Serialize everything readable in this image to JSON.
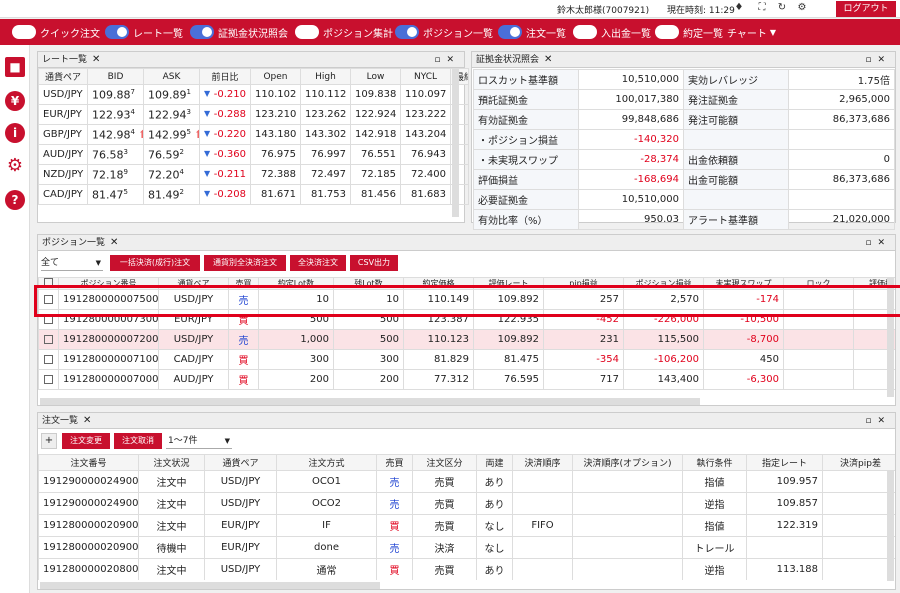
{
  "topbar": {
    "user": "鈴木太郎様(7007921)",
    "time": "現在時刻: 11:29",
    "logout": "ログアウト"
  },
  "toolbar": {
    "items": [
      {
        "label": "クイック注文",
        "on": false
      },
      {
        "label": "レート一覧",
        "on": true
      },
      {
        "label": "証拠金状況照会",
        "on": true
      },
      {
        "label": "ポジション集計",
        "on": false
      },
      {
        "label": "ポジション一覧",
        "on": true
      },
      {
        "label": "注文一覧",
        "on": true
      },
      {
        "label": "入出金一覧",
        "on": false
      },
      {
        "label": "約定一覧",
        "on": false
      }
    ],
    "chart": "チャート"
  },
  "rate_panel": {
    "title": "レート一覧",
    "headers": [
      "通貨ペア",
      "BID",
      "ASK",
      "前日比",
      "Open",
      "High",
      "Low",
      "NYCL",
      "最終"
    ],
    "rows": [
      {
        "pair": "USD/JPY",
        "bid": "109.88",
        "bid_sup": "7",
        "ask": "109.89",
        "ask_sup": "1",
        "change": "-0.210",
        "open": "110.102",
        "high": "110.112",
        "low": "109.838",
        "nycl": "110.097",
        "arrow": ""
      },
      {
        "pair": "EUR/JPY",
        "bid": "122.93",
        "bid_sup": "4",
        "ask": "122.94",
        "ask_sup": "3",
        "change": "-0.288",
        "open": "123.210",
        "high": "123.262",
        "low": "122.924",
        "nycl": "123.222",
        "arrow": ""
      },
      {
        "pair": "GBP/JPY",
        "bid": "142.98",
        "bid_sup": "4",
        "ask": "142.99",
        "ask_sup": "5",
        "change": "-0.220",
        "open": "143.180",
        "high": "143.302",
        "low": "142.918",
        "nycl": "143.204",
        "arrow": "up"
      },
      {
        "pair": "AUD/JPY",
        "bid": "76.58",
        "bid_sup": "3",
        "ask": "76.59",
        "ask_sup": "2",
        "change": "-0.360",
        "open": "76.975",
        "high": "76.997",
        "low": "76.551",
        "nycl": "76.943",
        "arrow": ""
      },
      {
        "pair": "NZD/JPY",
        "bid": "72.18",
        "bid_sup": "9",
        "ask": "72.20",
        "ask_sup": "4",
        "change": "-0.211",
        "open": "72.388",
        "high": "72.497",
        "low": "72.185",
        "nycl": "72.400",
        "arrow": ""
      },
      {
        "pair": "CAD/JPY",
        "bid": "81.47",
        "bid_sup": "5",
        "ask": "81.49",
        "ask_sup": "2",
        "change": "-0.208",
        "open": "81.671",
        "high": "81.753",
        "low": "81.456",
        "nycl": "81.683",
        "arrow": ""
      }
    ]
  },
  "margin_panel": {
    "title": "証拠金状況照会",
    "left": [
      {
        "k": "ロスカット基準額",
        "v": "10,510,000",
        "red": false
      },
      {
        "k": "預託証拠金",
        "v": "100,017,380",
        "red": false
      },
      {
        "k": "有効証拠金",
        "v": "99,848,686",
        "red": false
      },
      {
        "k": "・ポジション損益",
        "v": "-140,320",
        "red": true
      },
      {
        "k": "・未実現スワップ",
        "v": "-28,374",
        "red": true
      },
      {
        "k": "評価損益",
        "v": "-168,694",
        "red": true
      },
      {
        "k": "必要証拠金",
        "v": "10,510,000",
        "red": false
      },
      {
        "k": "有効比率（%）",
        "v": "950.03",
        "red": false
      }
    ],
    "right": [
      {
        "k": "実効レバレッジ",
        "v": "1.75倍"
      },
      {
        "k": "発注証拠金",
        "v": "2,965,000"
      },
      {
        "k": "発注可能額",
        "v": "86,373,686"
      },
      {
        "k": "",
        "v": ""
      },
      {
        "k": "出金依頼額",
        "v": "0"
      },
      {
        "k": "出金可能額",
        "v": "86,373,686"
      },
      {
        "k": "",
        "v": ""
      },
      {
        "k": "アラート基準額",
        "v": "21,020,000"
      }
    ]
  },
  "position_panel": {
    "title": "ポジション一覧",
    "filter": "全て",
    "buttons": [
      "一括決済(成行)注文",
      "通貨別全決済注文",
      "全決済注文",
      "CSV出力"
    ],
    "headers": [
      "",
      "ポジション番号",
      "通貨ペア",
      "売買",
      "約定Lot数",
      "残Lot数",
      "約定価格",
      "評価レート",
      "pip損益",
      "ポジション損益",
      "未実現スワップ",
      "ロック",
      "評価損"
    ],
    "rows": [
      {
        "id": "191280000007500",
        "pair": "USD/JPY",
        "side": "売",
        "lot": "10",
        "rem": "10",
        "price": "110.149",
        "rate": "109.892",
        "pip": "257",
        "pl": "2,570",
        "swap": "-174",
        "pink": false
      },
      {
        "id": "191280000007300",
        "pair": "EUR/JPY",
        "side": "買",
        "lot": "500",
        "rem": "500",
        "price": "123.387",
        "rate": "122.935",
        "pip": "-452",
        "pl": "-226,000",
        "swap": "-10,500",
        "pink": false
      },
      {
        "id": "191280000007200",
        "pair": "USD/JPY",
        "side": "売",
        "lot": "1,000",
        "rem": "500",
        "price": "110.123",
        "rate": "109.892",
        "pip": "231",
        "pl": "115,500",
        "swap": "-8,700",
        "pink": true
      },
      {
        "id": "191280000007100",
        "pair": "CAD/JPY",
        "side": "買",
        "lot": "300",
        "rem": "300",
        "price": "81.829",
        "rate": "81.475",
        "pip": "-354",
        "pl": "-106,200",
        "swap": "450",
        "pink": false
      },
      {
        "id": "191280000007000",
        "pair": "AUD/JPY",
        "side": "買",
        "lot": "200",
        "rem": "200",
        "price": "77.312",
        "rate": "76.595",
        "pip": "717",
        "pl": "143,400",
        "swap": "-6,300",
        "pink": false
      }
    ]
  },
  "order_panel": {
    "title": "注文一覧",
    "plus": "+",
    "buttons": [
      "注文変更",
      "注文取消"
    ],
    "range": "1～7件",
    "headers": [
      "注文番号",
      "注文状況",
      "通貨ペア",
      "注文方式",
      "売買",
      "注文区分",
      "両建",
      "決済順序",
      "決済順序(オプション)",
      "執行条件",
      "指定レート",
      "決済pip差"
    ],
    "rows": [
      {
        "id": "191290000024900",
        "status": "注文中",
        "pair": "USD/JPY",
        "method": "OCO1",
        "side": "売",
        "kind": "売買",
        "both": "あり",
        "order": "",
        "opt": "",
        "cond": "指値",
        "rate": "109.957"
      },
      {
        "id": "191290000024900",
        "status": "注文中",
        "pair": "USD/JPY",
        "method": "OCO2",
        "side": "売",
        "kind": "売買",
        "both": "あり",
        "order": "",
        "opt": "",
        "cond": "逆指",
        "rate": "109.857"
      },
      {
        "id": "191280000020900",
        "status": "注文中",
        "pair": "EUR/JPY",
        "method": "IF",
        "side": "買",
        "kind": "売買",
        "both": "なし",
        "order": "FIFO",
        "opt": "",
        "cond": "指値",
        "rate": "122.319"
      },
      {
        "id": "191280000020900",
        "status": "待機中",
        "pair": "EUR/JPY",
        "method": "done",
        "side": "売",
        "kind": "決済",
        "both": "なし",
        "order": "",
        "opt": "",
        "cond": "トレール",
        "rate": ""
      },
      {
        "id": "191280000020800",
        "status": "注文中",
        "pair": "USD/JPY",
        "method": "通常",
        "side": "買",
        "kind": "売買",
        "both": "あり",
        "order": "",
        "opt": "",
        "cond": "逆指",
        "rate": "113.188"
      }
    ]
  }
}
